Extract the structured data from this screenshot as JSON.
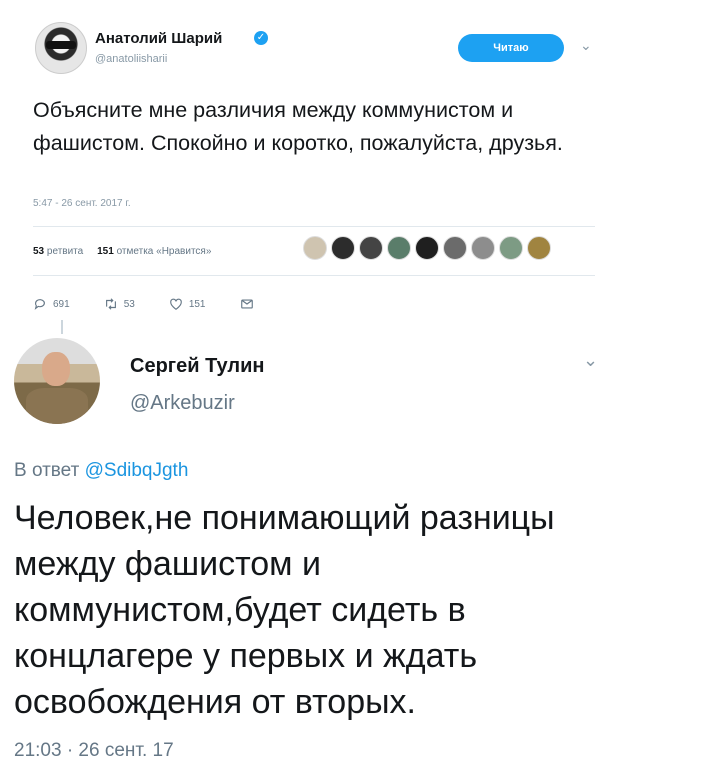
{
  "tweet": {
    "author_name": "Анатолий Шарий",
    "author_handle": "@anatoliisharii",
    "follow_label": "Читаю",
    "text": "Объясните мне различия между коммунистом и фашистом. Спокойно и коротко, пожалуйста, друзья.",
    "timestamp": "5:47 - 26 сент. 2017 г.",
    "retweets_count": "53",
    "retweets_label": "ретвита",
    "likes_count": "151",
    "likes_label": "отметка «Нравится»",
    "actions": {
      "replies": "691",
      "retweets": "53",
      "likes": "151"
    },
    "colors": {
      "accent": "#1da1f2",
      "muted": "#8899a6"
    }
  },
  "reply": {
    "author_name": "Сергей Тулин",
    "author_handle": "@Arkebuzir",
    "reply_prefix": "В ответ",
    "reply_mention": "@SdibqJgth",
    "text": "Человек,не понимающий разницы между фашистом и коммунистом,будет сидеть в концлагере у первых и ждать освобождения от вторых.",
    "timestamp": "21:03 · 26 сент. 17",
    "colors": {
      "link": "#1b95e0",
      "muted": "#657786"
    }
  },
  "icons": [
    "verified-icon",
    "chevron-down-icon",
    "reply-icon",
    "retweet-icon",
    "heart-icon",
    "message-icon"
  ]
}
